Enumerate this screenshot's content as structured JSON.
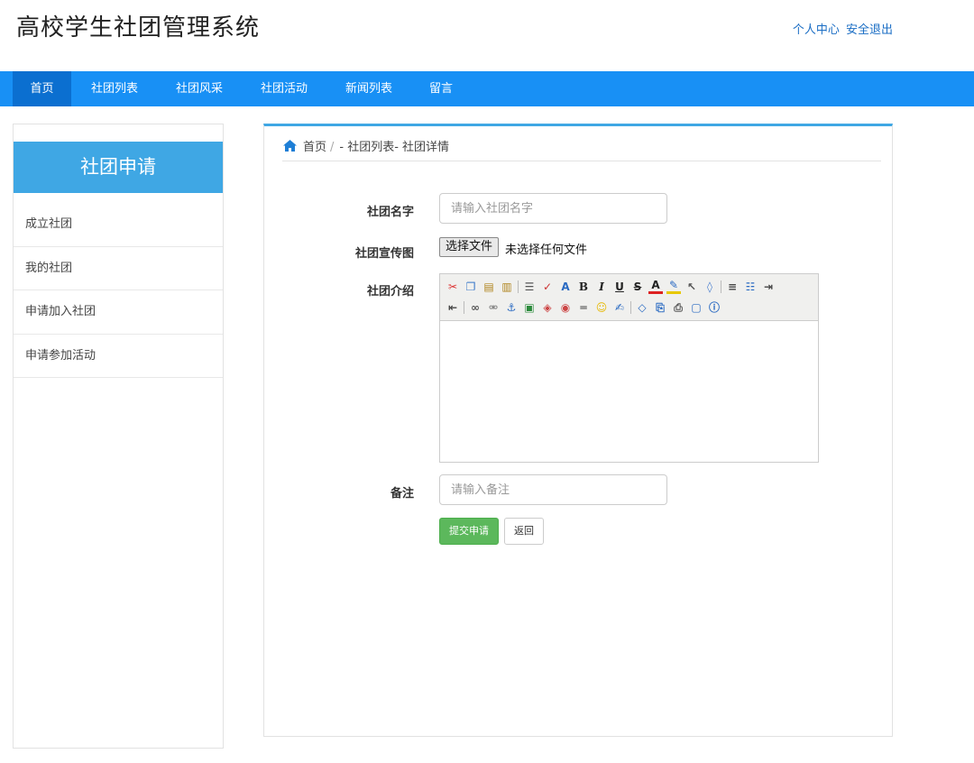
{
  "header": {
    "title": "高校学生社团管理系统",
    "links": [
      "个人中心",
      "安全退出"
    ]
  },
  "nav": {
    "items": [
      "首页",
      "社团列表",
      "社团风采",
      "社团活动",
      "新闻列表",
      "留言"
    ],
    "active_index": 0
  },
  "sidebar": {
    "header": "社团申请",
    "items": [
      "成立社团",
      "我的社团",
      "申请加入社团",
      "申请参加活动"
    ]
  },
  "breadcrumb": {
    "home": "首页",
    "separator": "/",
    "path": "- 社团列表- 社团详情"
  },
  "form": {
    "name_label": "社团名字",
    "name_placeholder": "请输入社团名字",
    "poster_label": "社团宣传图",
    "file_button": "选择文件",
    "file_status": "未选择任何文件",
    "intro_label": "社团介绍",
    "remark_label": "备注",
    "remark_placeholder": "请输入备注",
    "submit_label": "提交申请",
    "back_label": "返回"
  },
  "editor": {
    "row1": [
      "cut-icon",
      "copy-icon",
      "paste-icon",
      "paste-text-icon",
      "sep",
      "justify-icon",
      "spellcheck-icon",
      "font-size-icon",
      "bold-icon",
      "italic-icon",
      "underline-icon",
      "strikethrough-icon",
      "font-color-icon",
      "highlight-icon",
      "select-icon",
      "eraser-icon",
      "sep",
      "align-left-icon",
      "ordered-list-icon",
      "indent-icon"
    ],
    "row2": [
      "outdent-icon",
      "sep",
      "link-icon",
      "unlink-icon",
      "anchor-icon",
      "image-icon",
      "flash-icon",
      "media-icon",
      "hr-icon",
      "emoticon-icon",
      "template-icon",
      "sep",
      "source-icon",
      "preview-icon",
      "print-icon",
      "fullscreen-icon",
      "about-icon"
    ]
  },
  "colors": {
    "nav_bg": "#1890f5",
    "nav_active": "#0b6fd0",
    "accent": "#3fa7e4",
    "link": "#1a6dc4",
    "submit": "#5cb85c"
  }
}
